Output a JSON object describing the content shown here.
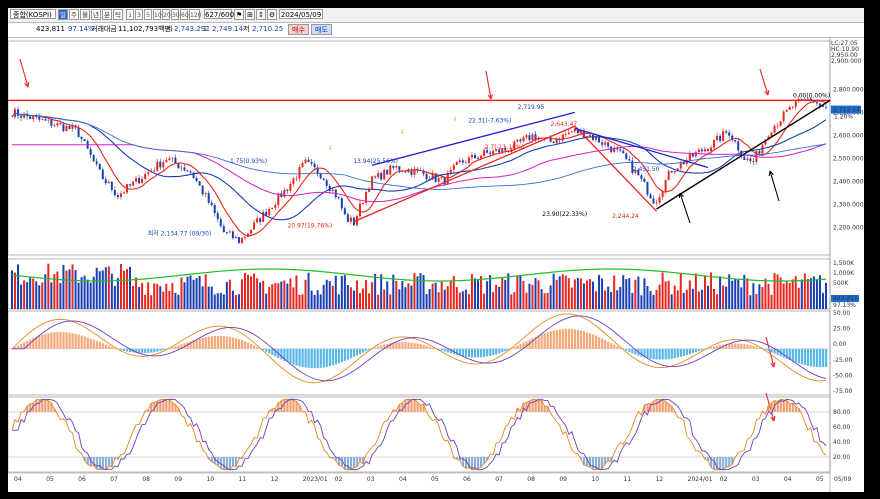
{
  "toolbar": {
    "symbol": "종합(KOSPI)",
    "periods": [
      "일",
      "주",
      "월",
      "년",
      "분",
      "틱"
    ],
    "selected_period": "일",
    "numbers": [
      "1",
      "3",
      "5",
      "10",
      "20",
      "30",
      "60",
      "120"
    ],
    "count": "627/600",
    "date": "2024/05/09"
  },
  "quote": {
    "volume": "423,811",
    "vol_ratio": "97.14%",
    "amount_label": "거래대금",
    "amount": "11,102,793백만",
    "open_label": "시",
    "open": "2,743.29",
    "high_label": "고",
    "high": "2,749.14",
    "low_label": "저",
    "low": "2,710.25",
    "buy": "매수",
    "sell": "매도"
  },
  "price_axis": {
    "labels": [
      "2,800.000",
      "2,700.000",
      "2,600.000",
      "2,500.000",
      "2,400.000",
      "2,300.000",
      "2,200.000"
    ],
    "values": [
      2800,
      2700,
      2600,
      2500,
      2400,
      2300,
      2200
    ],
    "range": [
      2080,
      3010
    ],
    "top_labels": [
      "LC:27.05",
      "HC:10.90",
      "2,950.00",
      "2,900.000"
    ],
    "current": "2,712.14",
    "change": "1.20%"
  },
  "volume_axis": {
    "labels": [
      "1,500K",
      "1,000K",
      "500K"
    ],
    "current": "423,811",
    "ratio": "97.13%"
  },
  "macd_axis": {
    "labels": [
      "50.00",
      "25.00",
      "0.00",
      "-25.00",
      "-50.00",
      "-75.00"
    ]
  },
  "stoch_axis": {
    "labels": [
      "80.00",
      "60.00",
      "40.00",
      "20.00"
    ]
  },
  "x_axis": {
    "labels": [
      "04",
      "05",
      "06",
      "07",
      "08",
      "09",
      "10",
      "11",
      "12",
      "2023/01",
      "02",
      "03",
      "04",
      "05",
      "06",
      "07",
      "08",
      "09",
      "10",
      "11",
      "12",
      "2024/01",
      "02",
      "03",
      "04",
      "05"
    ],
    "end_label": "05/09"
  },
  "annotations": {
    "low_2022": "최저 2,134.77 (09/30)",
    "a1": "1.75(0.93%)",
    "a2": "20.97(19.76%)",
    "a3": "13.94(25.56%)",
    "a4": "2,719.95",
    "a5": "22.31(-7.63%)",
    "a6": "2,643.47",
    "a7": "2.7(-11.18%)",
    "a8": "23.90(22.33%)",
    "a9": "2,244.24",
    "a10": "2,451.50",
    "a11": "0.00(0.00%)",
    "a12": "2"
  },
  "colors": {
    "up": "#e8261d",
    "down": "#1a3fb3",
    "resistance": "#e8261d",
    "trendline": "#000000",
    "ma_short": "#e8261d",
    "ma_mid": "#1a3fb3",
    "ma_long": "#d020c8",
    "ma_longer": "#3a6fd0",
    "volume_ma": "#1fbf1f",
    "macd_pos": "#f5a97a",
    "macd_neg": "#5ab7e8",
    "stoch_overbought": "#f29d70",
    "stoch_oversold": "#8ab0d8"
  },
  "icons": [
    "settings-icon",
    "chart-type-icon",
    "period-icon",
    "arrow-down-icon",
    "arrow-up-icon",
    "buy-arrow-icon"
  ]
}
